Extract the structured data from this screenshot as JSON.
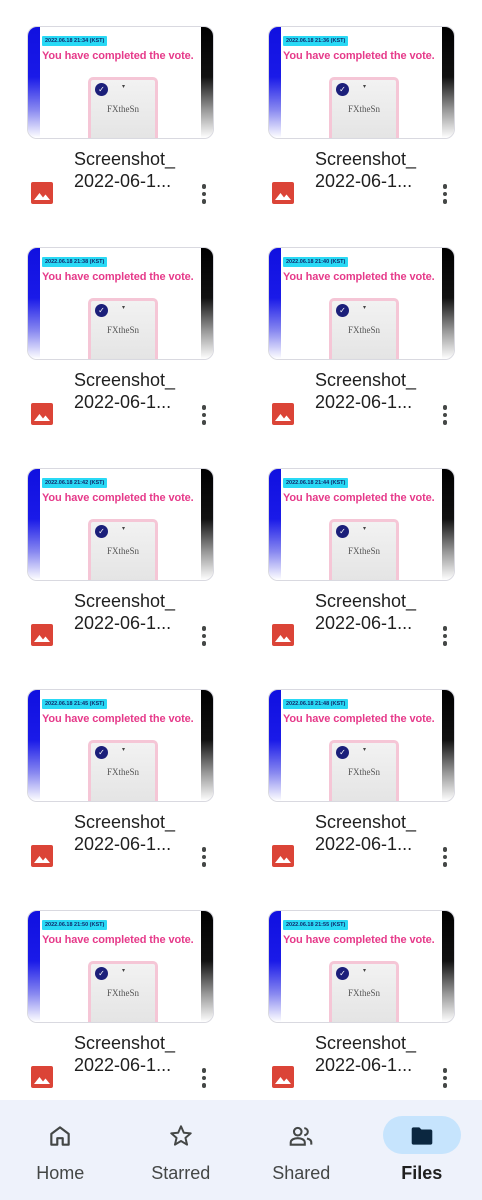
{
  "files": [
    {
      "name_line1": "Screenshot_",
      "name_line2": "2022-06-1...",
      "thumb_stamp": "2022.06.18 21:34 (KST)",
      "thumb_message": "You have completed the vote.",
      "thumb_logo": "FXtheSn"
    },
    {
      "name_line1": "Screenshot_",
      "name_line2": "2022-06-1...",
      "thumb_stamp": "2022.06.18 21:36 (KST)",
      "thumb_message": "You have completed the vote.",
      "thumb_logo": "FXtheSn"
    },
    {
      "name_line1": "Screenshot_",
      "name_line2": "2022-06-1...",
      "thumb_stamp": "2022.06.18 21:38 (KST)",
      "thumb_message": "You have completed the vote.",
      "thumb_logo": "FXtheSn"
    },
    {
      "name_line1": "Screenshot_",
      "name_line2": "2022-06-1...",
      "thumb_stamp": "2022.06.18 21:40 (KST)",
      "thumb_message": "You have completed the vote.",
      "thumb_logo": "FXtheSn"
    },
    {
      "name_line1": "Screenshot_",
      "name_line2": "2022-06-1...",
      "thumb_stamp": "2022.06.18 21:42 (KST)",
      "thumb_message": "You have completed the vote.",
      "thumb_logo": "FXtheSn"
    },
    {
      "name_line1": "Screenshot_",
      "name_line2": "2022-06-1...",
      "thumb_stamp": "2022.06.18 21:44 (KST)",
      "thumb_message": "You have completed the vote.",
      "thumb_logo": "FXtheSn"
    },
    {
      "name_line1": "Screenshot_",
      "name_line2": "2022-06-1...",
      "thumb_stamp": "2022.06.18 21:45 (KST)",
      "thumb_message": "You have completed the vote.",
      "thumb_logo": "FXtheSn"
    },
    {
      "name_line1": "Screenshot_",
      "name_line2": "2022-06-1...",
      "thumb_stamp": "2022.06.18 21:48 (KST)",
      "thumb_message": "You have completed the vote.",
      "thumb_logo": "FXtheSn"
    },
    {
      "name_line1": "Screenshot_",
      "name_line2": "2022-06-1...",
      "thumb_stamp": "2022.06.18 21:50 (KST)",
      "thumb_message": "You have completed the vote.",
      "thumb_logo": "FXtheSn"
    },
    {
      "name_line1": "Screenshot_",
      "name_line2": "2022-06-1...",
      "thumb_stamp": "2022.06.18 21:55 (KST)",
      "thumb_message": "You have completed the vote.",
      "thumb_logo": "FXtheSn"
    }
  ],
  "nav": {
    "items": [
      {
        "label": "Home",
        "icon": "home-icon",
        "active": false
      },
      {
        "label": "Starred",
        "icon": "star-icon",
        "active": false
      },
      {
        "label": "Shared",
        "icon": "people-icon",
        "active": false
      },
      {
        "label": "Files",
        "icon": "folder-icon",
        "active": true
      }
    ]
  },
  "colors": {
    "image_file_icon": "#db4437",
    "vote_message": "#e63a8a",
    "stamp_bg": "#29d9f5",
    "nav_bg": "#eef2fb",
    "active_pill": "#c6e4fd"
  }
}
